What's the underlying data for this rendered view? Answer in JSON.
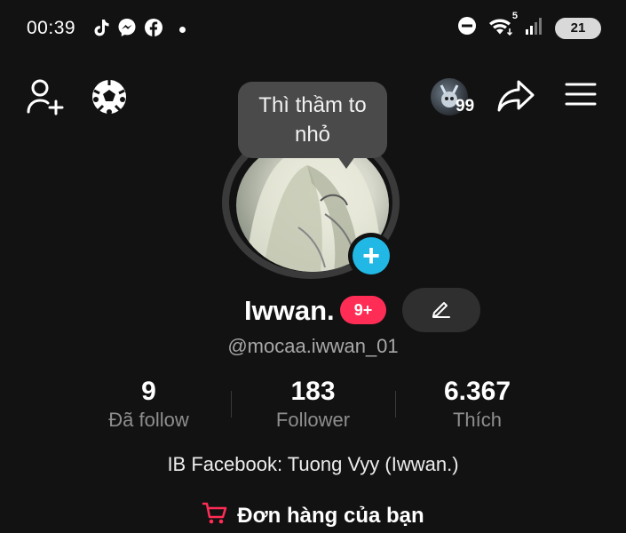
{
  "status_bar": {
    "time": "00:39",
    "network_badge": "5",
    "battery": "21",
    "icons": [
      "tiktok-icon",
      "messenger-icon",
      "facebook-icon",
      "do-not-disturb-icon",
      "wifi-icon",
      "signal-icon",
      "battery-icon"
    ]
  },
  "header": {
    "icons": [
      "add-user-icon",
      "soccer-ball-icon",
      "profile-view-avatar",
      "share-icon",
      "menu-icon"
    ],
    "avatar_badge": "99"
  },
  "tooltip": {
    "text": "Thì thầm to nhỏ"
  },
  "profile": {
    "name": "Iwwan.",
    "badge": "9+",
    "handle": "@mocaa.iwwan_01"
  },
  "stats": [
    {
      "value": "9",
      "label": "Đã follow"
    },
    {
      "value": "183",
      "label": "Follower"
    },
    {
      "value": "6.367",
      "label": "Thích"
    }
  ],
  "bio": "IB Facebook: Tuong Vyy (Iwwan.)",
  "orders": {
    "label": "Đơn hàng của bạn",
    "icon": "cart-icon"
  },
  "colors": {
    "background": "#121212",
    "accent_blue": "#21b8e6",
    "badge_red": "#ff2d55",
    "cart_red": "#ff2d55"
  }
}
